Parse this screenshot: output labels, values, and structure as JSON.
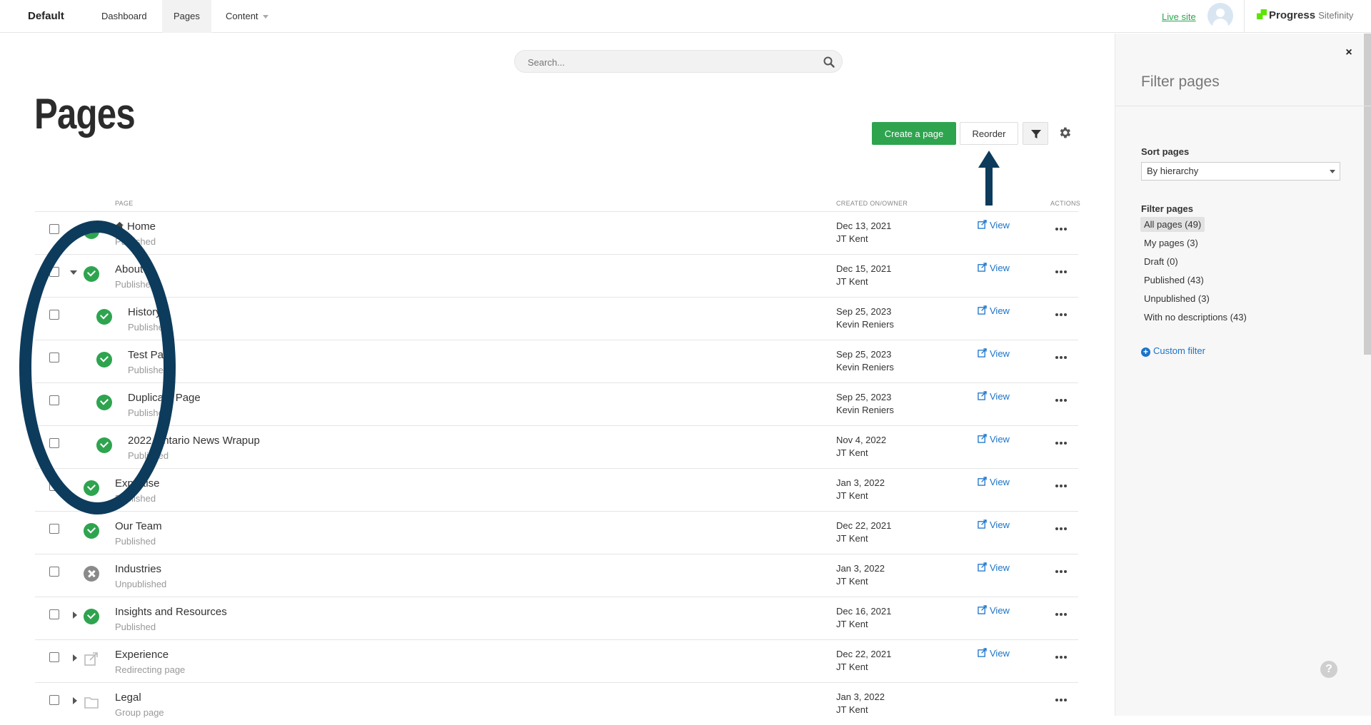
{
  "topbar": {
    "brand": "Default",
    "nav": [
      {
        "label": "Dashboard",
        "active": false
      },
      {
        "label": "Pages",
        "active": true
      },
      {
        "label": "Content",
        "active": false
      }
    ],
    "live_site": "Live site",
    "logo_text": "Progress",
    "logo_sub": "Sitefinity"
  },
  "search": {
    "placeholder": "Search..."
  },
  "page_title": "Pages",
  "toolbar": {
    "create_label": "Create a page",
    "reorder_label": "Reorder"
  },
  "columns": {
    "page": "PAGE",
    "created": "CREATED ON/OWNER",
    "actions": "ACTIONS"
  },
  "rows": [
    {
      "name": "Home",
      "status": "Published",
      "date": "Dec 13, 2021",
      "owner": "JT Kent",
      "view": "View",
      "indent": 0,
      "caret": "none",
      "icon": "ok",
      "home": true
    },
    {
      "name": "About",
      "status": "Published",
      "date": "Dec 15, 2021",
      "owner": "JT Kent",
      "view": "View",
      "indent": 0,
      "caret": "down",
      "icon": "ok"
    },
    {
      "name": "History",
      "status": "Published",
      "date": "Sep 25, 2023",
      "owner": "Kevin Reniers",
      "view": "View",
      "indent": 1,
      "caret": "none",
      "icon": "ok"
    },
    {
      "name": "Test Page",
      "status": "Published",
      "date": "Sep 25, 2023",
      "owner": "Kevin Reniers",
      "view": "View",
      "indent": 1,
      "caret": "none",
      "icon": "ok"
    },
    {
      "name": "Duplicate Page",
      "status": "Published",
      "date": "Sep 25, 2023",
      "owner": "Kevin Reniers",
      "view": "View",
      "indent": 1,
      "caret": "none",
      "icon": "ok"
    },
    {
      "name": "2022 Ontario News Wrapup",
      "status": "Published",
      "date": "Nov 4, 2022",
      "owner": "JT Kent",
      "view": "View",
      "indent": 1,
      "caret": "none",
      "icon": "ok"
    },
    {
      "name": "Expertise",
      "status": "Published",
      "date": "Jan 3, 2022",
      "owner": "JT Kent",
      "view": "View",
      "indent": 0,
      "caret": "none",
      "icon": "ok"
    },
    {
      "name": "Our Team",
      "status": "Published",
      "date": "Dec 22, 2021",
      "owner": "JT Kent",
      "view": "View",
      "indent": 0,
      "caret": "none",
      "icon": "ok"
    },
    {
      "name": "Industries",
      "status": "Unpublished",
      "date": "Jan 3, 2022",
      "owner": "JT Kent",
      "view": "View",
      "indent": 0,
      "caret": "none",
      "icon": "unpub"
    },
    {
      "name": "Insights and Resources",
      "status": "Published",
      "date": "Dec 16, 2021",
      "owner": "JT Kent",
      "view": "View",
      "indent": 0,
      "caret": "right",
      "icon": "ok"
    },
    {
      "name": "Experience",
      "status": "Redirecting page",
      "date": "Dec 22, 2021",
      "owner": "JT Kent",
      "view": "View",
      "indent": 0,
      "caret": "right",
      "icon": "redirect"
    },
    {
      "name": "Legal",
      "status": "Group page",
      "date": "Jan 3, 2022",
      "owner": "JT Kent",
      "view": "",
      "indent": 0,
      "caret": "right",
      "icon": "group"
    }
  ],
  "sidebar": {
    "close": "×",
    "title": "Filter pages",
    "sort_label": "Sort pages",
    "sort_value": "By hierarchy",
    "filter_label": "Filter pages",
    "filters": [
      {
        "label": "All pages (49)",
        "selected": true
      },
      {
        "label": "My pages (3)",
        "selected": false
      },
      {
        "label": "Draft (0)",
        "selected": false
      },
      {
        "label": "Published (43)",
        "selected": false
      },
      {
        "label": "Unpublished (3)",
        "selected": false
      },
      {
        "label": "With no descriptions (43)",
        "selected": false
      }
    ],
    "custom_filter": "Custom filter",
    "help": "?"
  },
  "colors": {
    "accent_green": "#2ea44f",
    "link_blue": "#1a73c9",
    "annotation": "#0d3b5c"
  }
}
